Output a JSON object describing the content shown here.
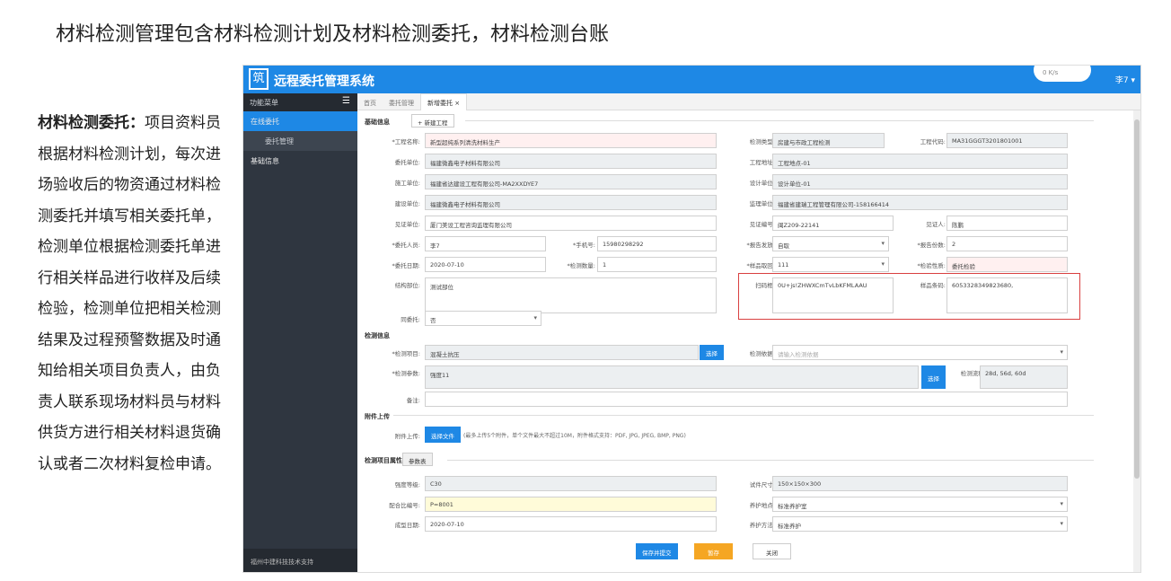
{
  "slide_title": "材料检测管理包含材料检测计划及材料检测委托，材料检测台账",
  "desc": {
    "heading": "材料检测委托：",
    "body": "项目资料员根据材料检测计划，每次进场验收后的物资通过材料检测委托并填写相关委托单，检测单位根据检测委托单进行相关样品进行收样及后续检验，检测单位把相关检测结果及过程预警数据及时通知给相关项目负责人，由负责人联系现场材料员与材料供货方进行相关材料退货确认或者二次材料复检申请。"
  },
  "app": {
    "logo": "筑",
    "title": "远程委托管理系统",
    "weather": "0 K/s",
    "user": "李7 ▾",
    "sidebar": {
      "header": "功能菜单",
      "toggle": "☰",
      "items": [
        {
          "label": "在线委托"
        },
        {
          "label": "委托管理"
        },
        {
          "label": "基础信息"
        }
      ],
      "footer": "福州中建科技技术支持"
    },
    "tabs": [
      "首页",
      "委托管理",
      "新增委托 ×"
    ],
    "sections": {
      "basic": "基础信息",
      "add_project": "+ 新建工程",
      "detect": "检测信息",
      "attach": "附件上传",
      "params": "检测项目属性",
      "params_btn": "参数表"
    },
    "fields": {
      "project_name_label": "*工程名称:",
      "project_name": "新型超纯系列清洗材料生产",
      "check_type_label": "检测类型:",
      "check_type": "房建与市政工程检测",
      "project_code_label": "工程代码:",
      "project_code": "MA31GGGT3201801001",
      "client_label": "委托单位:",
      "client": "福建微鑫电子材料有限公司",
      "site_label": "工程地址:",
      "site": "工程地点-01",
      "builder_label": "施工单位:",
      "builder": "福建省达建设工程有限公司-MA2XXDYE7",
      "designer_label": "设计单位:",
      "designer": "设计单位-01",
      "owner_label": "建设单位:",
      "owner": "福建微鑫电子材料有限公司",
      "supervisor_label": "监理单位:",
      "supervisor": "福建省建瑞工程管理有限公司-158166414",
      "witness_unit_label": "见证单位:",
      "witness_unit": "厦门美设工程咨询监理有限公司",
      "witness_no_label": "见证编号:",
      "witness_no": "闽Z209-22141",
      "witness_person_label": "见证人:",
      "witness_person": "陈鹏",
      "client_person_label": "*委托人员:",
      "client_person": "李7",
      "phone_label": "*手机号:",
      "phone": "15980298292",
      "report_mode_label": "*报告发放:",
      "report_mode": "自取",
      "report_count_label": "*报告份数:",
      "report_count": "2",
      "date_label": "*委托日期:",
      "date": "2020-07-10",
      "qty_label": "*检测数量:",
      "qty": "1",
      "sample_label": "*样品取回:",
      "sample": "111",
      "nature_label": "*检验性质:",
      "nature": "委托检验",
      "part_label": "结构部位:",
      "part": "测试部位",
      "scan_label": "扫码框:",
      "scan": "0U+js!ZHWXCmTvLbKFMLAAU",
      "barcode_label": "样品条码:",
      "barcode": "6053328349823680,",
      "same_label": "同委托:",
      "same": "否",
      "item_label": "*检测项目:",
      "item": "混凝土抗压",
      "choose": "选择",
      "basis_label": "检测依据:",
      "basis_ph": "请输入检测依据",
      "param_label": "*检测参数:",
      "param": "强度11",
      "flow_label": "检测流程:",
      "flow": "28d, 56d, 60d",
      "remark_label": "备注:",
      "attach_label": "附件上传:",
      "attach_btn": "选择文件",
      "attach_hint": "(最多上传5个附件，单个文件最大不超过10M，附件格式支持：PDF, JPG, JPEG, BMP, PNG)",
      "grade_label": "强度等级:",
      "grade": "C30",
      "size_label": "试件尺寸:",
      "size": "150×150×300",
      "mix_label": "配合比编号:",
      "mix": "P=8001",
      "cure_place_label": "养护地点:",
      "cure_place": "标准养护室",
      "form_date_label": "成型日期:",
      "form_date": "2020-07-10",
      "cure_way_label": "养护方法:",
      "cure_way": "标准养护"
    },
    "buttons": {
      "save_submit": "保存并提交",
      "save": "暂存",
      "close": "关闭"
    }
  }
}
